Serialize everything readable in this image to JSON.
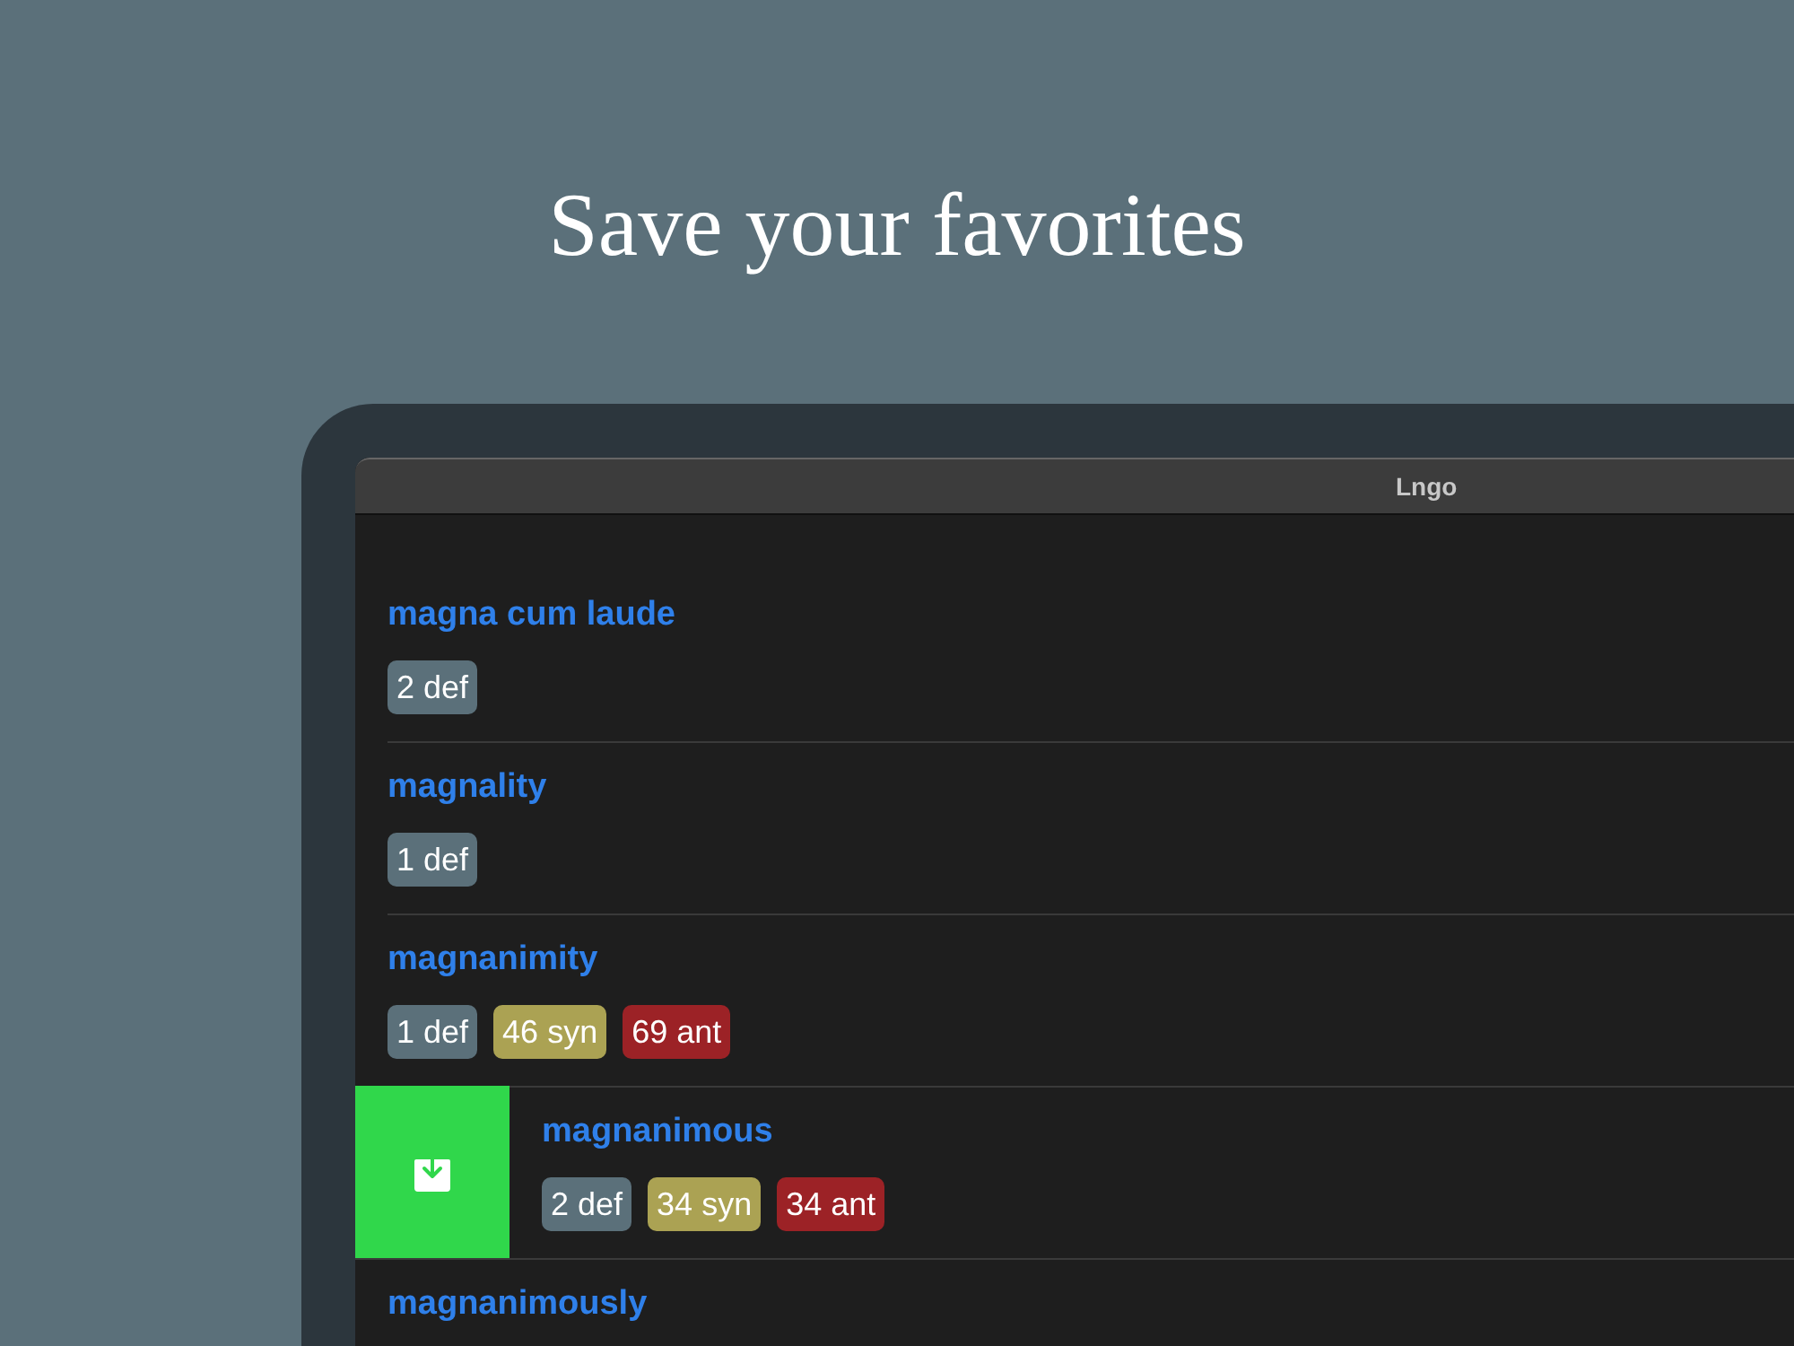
{
  "headline": "Save your favorites",
  "window": {
    "title": "Lngo"
  },
  "entries": [
    {
      "word": "magna cum laude",
      "swiped": false,
      "badges": [
        {
          "kind": "def",
          "label": "2 def"
        }
      ]
    },
    {
      "word": "magnality",
      "swiped": false,
      "badges": [
        {
          "kind": "def",
          "label": "1 def"
        }
      ]
    },
    {
      "word": "magnanimity",
      "swiped": false,
      "badges": [
        {
          "kind": "def",
          "label": "1 def"
        },
        {
          "kind": "syn",
          "label": "46 syn"
        },
        {
          "kind": "ant",
          "label": "69 ant"
        }
      ]
    },
    {
      "word": "magnanimous",
      "swiped": true,
      "badges": [
        {
          "kind": "def",
          "label": "2 def"
        },
        {
          "kind": "syn",
          "label": "34 syn"
        },
        {
          "kind": "ant",
          "label": "34 ant"
        }
      ]
    },
    {
      "word": "magnanimously",
      "swiped": false
    }
  ]
}
